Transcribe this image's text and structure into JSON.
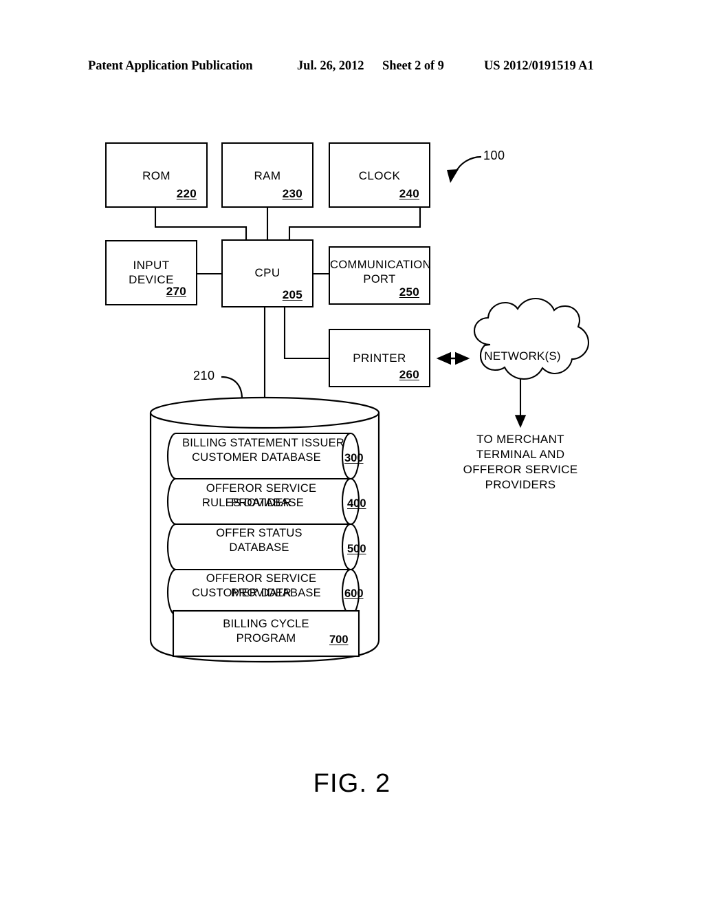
{
  "header": {
    "publication": "Patent Application Publication",
    "date": "Jul. 26, 2012",
    "sheet": "Sheet 2 of 9",
    "number": "US 2012/0191519 A1"
  },
  "figure": {
    "caption": "FIG. 2",
    "system_ref": "100",
    "storage_ref": "210",
    "cloud_label": "NETWORK(S)",
    "network_destination": "TO MERCHANT\nTERMINAL AND\nOFFEROR SERVICE\nPROVIDERS",
    "network_destination_lines": [
      "TO MERCHANT",
      "TERMINAL AND",
      "OFFEROR SERVICE",
      "PROVIDERS"
    ],
    "nodes": [
      {
        "id": "rom",
        "label": "ROM",
        "lines": [
          "ROM"
        ],
        "ref": "220"
      },
      {
        "id": "ram",
        "label": "RAM",
        "lines": [
          "RAM"
        ],
        "ref": "230"
      },
      {
        "id": "clock",
        "label": "CLOCK",
        "lines": [
          "CLOCK"
        ],
        "ref": "240"
      },
      {
        "id": "input",
        "label": "INPUT DEVICE",
        "lines": [
          "INPUT",
          "DEVICE"
        ],
        "ref": "270"
      },
      {
        "id": "cpu",
        "label": "CPU",
        "lines": [
          "CPU"
        ],
        "ref": "205"
      },
      {
        "id": "commport",
        "label": "COMMUNICATION PORT",
        "lines": [
          "COMMUNICATION",
          "PORT"
        ],
        "ref": "250"
      },
      {
        "id": "printer",
        "label": "PRINTER",
        "lines": [
          "PRINTER"
        ],
        "ref": "260"
      }
    ],
    "storage_items": [
      {
        "id": "db300",
        "lines": [
          "BILLING STATEMENT ISSUER",
          "CUSTOMER DATABASE"
        ],
        "ref": "300",
        "shape": "cylinder"
      },
      {
        "id": "db400",
        "lines": [
          "OFFEROR SERVICE PROVIDER",
          "RULES DATABASE"
        ],
        "ref": "400",
        "shape": "cylinder"
      },
      {
        "id": "db500",
        "lines": [
          "OFFER STATUS",
          "DATABASE"
        ],
        "ref": "500",
        "shape": "cylinder"
      },
      {
        "id": "db600",
        "lines": [
          "OFFEROR SERVICE PROVIDER",
          "CUSTOMER DATABASE"
        ],
        "ref": "600",
        "shape": "cylinder"
      },
      {
        "id": "db700",
        "lines": [
          "BILLING CYCLE",
          "PROGRAM"
        ],
        "ref": "700",
        "shape": "rectangle"
      }
    ]
  }
}
